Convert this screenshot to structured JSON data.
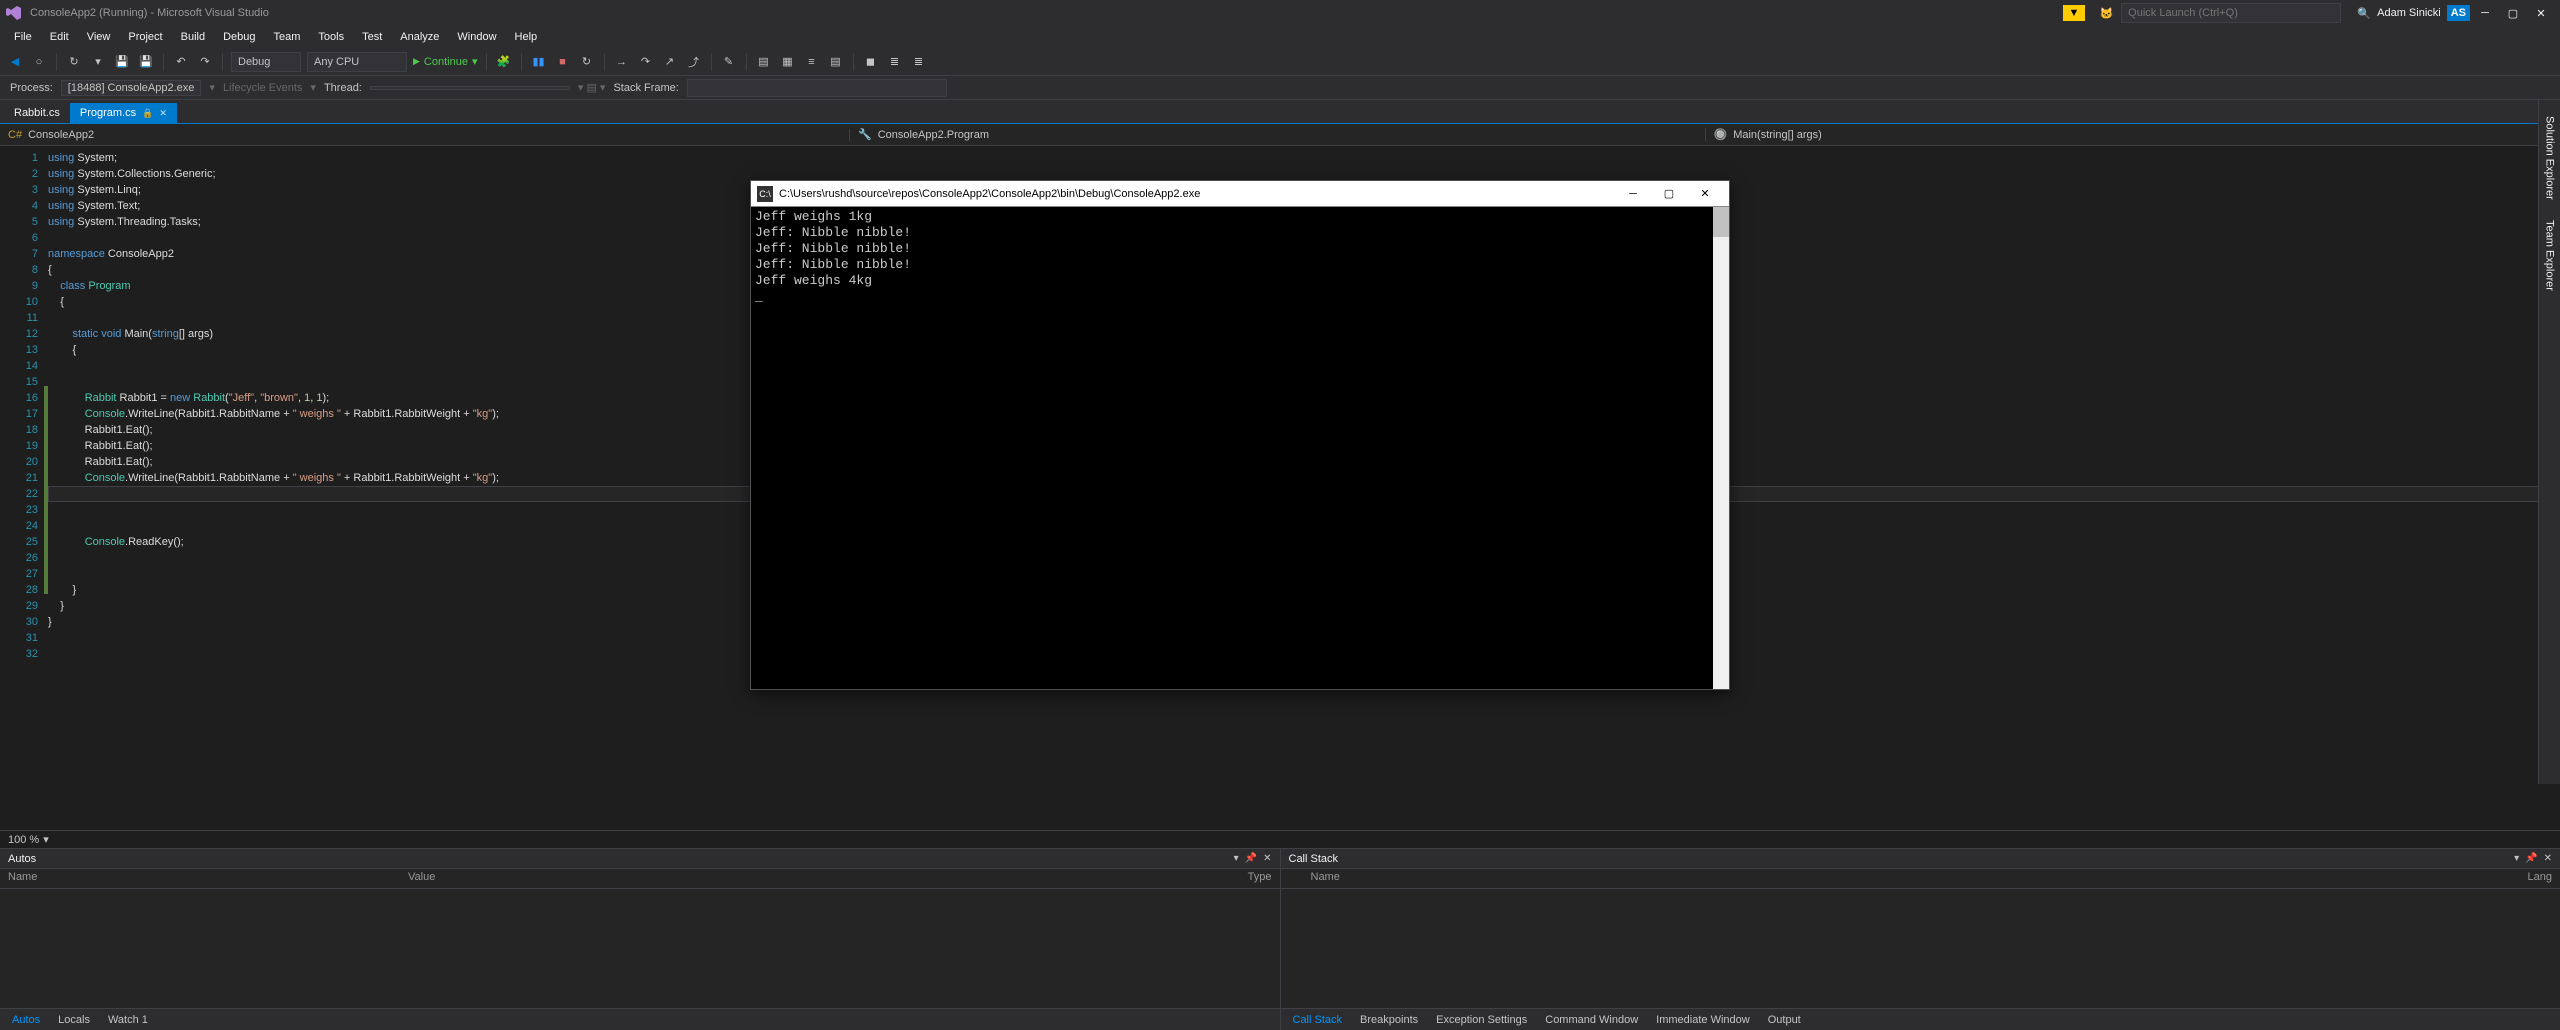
{
  "title": "ConsoleApp2 (Running) - Microsoft Visual Studio",
  "quicklaunch_placeholder": "Quick Launch (Ctrl+Q)",
  "user": "Adam Sinicki",
  "user_initials": "AS",
  "menu": [
    "File",
    "Edit",
    "View",
    "Project",
    "Build",
    "Debug",
    "Team",
    "Tools",
    "Test",
    "Analyze",
    "Window",
    "Help"
  ],
  "toolbar": {
    "config": "Debug",
    "platform": "Any CPU",
    "continue": "Continue"
  },
  "process": {
    "label": "Process:",
    "value": "[18488] ConsoleApp2.exe",
    "lifecycle": "Lifecycle Events",
    "thread_label": "Thread:",
    "stackframe_label": "Stack Frame:"
  },
  "tabs": [
    {
      "label": "Rabbit.cs",
      "active": false
    },
    {
      "label": "Program.cs",
      "active": true
    }
  ],
  "navrow": {
    "project": "ConsoleApp2",
    "class": "ConsoleApp2.Program",
    "method": "Main(string[] args)"
  },
  "side_tabs": [
    "Solution Explorer",
    "Team Explorer"
  ],
  "zoom": "100 %",
  "code_lines": [
    {
      "n": 1,
      "html": "<span class='k'>using</span> System;"
    },
    {
      "n": 2,
      "html": "<span class='k'>using</span> System.Collections.Generic;"
    },
    {
      "n": 3,
      "html": "<span class='k'>using</span> System.Linq;"
    },
    {
      "n": 4,
      "html": "<span class='k'>using</span> System.Text;"
    },
    {
      "n": 5,
      "html": "<span class='k'>using</span> System.Threading.Tasks;"
    },
    {
      "n": 6,
      "html": ""
    },
    {
      "n": 7,
      "html": "<span class='k'>namespace</span> ConsoleApp2"
    },
    {
      "n": 8,
      "html": "{"
    },
    {
      "n": 9,
      "html": "    <span class='k'>class</span> <span class='t'>Program</span>"
    },
    {
      "n": 10,
      "html": "    {"
    },
    {
      "n": 11,
      "html": ""
    },
    {
      "n": 12,
      "html": "        <span class='k'>static</span> <span class='k'>void</span> Main(<span class='k'>string</span>[] args)"
    },
    {
      "n": 13,
      "html": "        {"
    },
    {
      "n": 14,
      "html": ""
    },
    {
      "n": 15,
      "html": ""
    },
    {
      "n": 16,
      "html": "            <span class='t'>Rabbit</span> Rabbit1 = <span class='k'>new</span> <span class='t'>Rabbit</span>(<span class='s'>\"Jeff\"</span>, <span class='s'>\"brown\"</span>, <span class='n'>1</span>, <span class='n'>1</span>);"
    },
    {
      "n": 17,
      "html": "            <span class='t'>Console</span>.WriteLine(Rabbit1.RabbitName + <span class='s'>\" weighs \"</span> + Rabbit1.RabbitWeight + <span class='s'>\"kg\"</span>);"
    },
    {
      "n": 18,
      "html": "            Rabbit1.Eat();"
    },
    {
      "n": 19,
      "html": "            Rabbit1.Eat();"
    },
    {
      "n": 20,
      "html": "            Rabbit1.Eat();"
    },
    {
      "n": 21,
      "html": "            <span class='t'>Console</span>.WriteLine(Rabbit1.RabbitName + <span class='s'>\" weighs \"</span> + Rabbit1.RabbitWeight + <span class='s'>\"kg\"</span>);"
    },
    {
      "n": 22,
      "html": "",
      "current": true
    },
    {
      "n": 23,
      "html": ""
    },
    {
      "n": 24,
      "html": ""
    },
    {
      "n": 25,
      "html": "            <span class='t'>Console</span>.ReadKey();"
    },
    {
      "n": 26,
      "html": ""
    },
    {
      "n": 27,
      "html": ""
    },
    {
      "n": 28,
      "html": "        }"
    },
    {
      "n": 29,
      "html": "    }"
    },
    {
      "n": 30,
      "html": "}"
    },
    {
      "n": 31,
      "html": ""
    },
    {
      "n": 32,
      "html": ""
    }
  ],
  "console": {
    "title": "C:\\Users\\rushd\\source\\repos\\ConsoleApp2\\ConsoleApp2\\bin\\Debug\\ConsoleApp2.exe",
    "lines": [
      "Jeff weighs 1kg",
      "Jeff: Nibble nibble!",
      "Jeff: Nibble nibble!",
      "Jeff: Nibble nibble!",
      "Jeff weighs 4kg",
      "_"
    ]
  },
  "autos": {
    "title": "Autos",
    "cols": [
      "Name",
      "Value",
      "Type"
    ],
    "tabs": [
      "Autos",
      "Locals",
      "Watch 1"
    ]
  },
  "callstack": {
    "title": "Call Stack",
    "cols": [
      "Name",
      "Lang"
    ],
    "tabs": [
      "Call Stack",
      "Breakpoints",
      "Exception Settings",
      "Command Window",
      "Immediate Window",
      "Output"
    ]
  }
}
